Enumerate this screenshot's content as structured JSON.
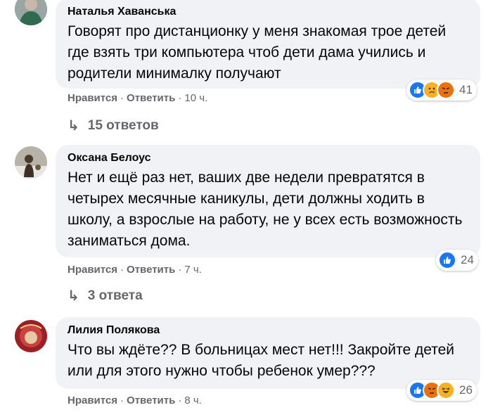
{
  "comments": [
    {
      "author": "Наталья Хаванська",
      "text": "Говорят про дистанционку у меня знакомая трое детей где взять три компьютера чтоб дети дама учились и родители минималку получают",
      "like_label": "Нравится",
      "reply_label": "Ответить",
      "time": "10 ч.",
      "reactions": [
        "like-icon",
        "sad-icon",
        "angry-icon"
      ],
      "reaction_count": "41",
      "replies_label": "15 ответов"
    },
    {
      "author": "Оксана Белоус",
      "text": "Нет и ещё раз нет, ваших две недели превратятся в четырех месячные каникулы, дети должны ходить в школу, а взрослые на работу, не у всех есть возможность заниматься дома.",
      "like_label": "Нравится",
      "reply_label": "Ответить",
      "time": "7 ч.",
      "reactions": [
        "like-icon"
      ],
      "reaction_count": "24",
      "replies_label": "3 ответа"
    },
    {
      "author": "Лилия Полякова",
      "text": "Что вы ждёте?? В больницах мест нет!!! Закройте детей или для этого нужно чтобы ребенок умер???",
      "like_label": "Нравится",
      "reply_label": "Ответить",
      "time": "8 ч.",
      "reactions": [
        "like-icon",
        "angry-icon",
        "haha-icon"
      ],
      "reaction_count": "26"
    }
  ],
  "separator": "·",
  "reply_arrow": "↳",
  "colors": {
    "like": "#1877f2",
    "sad": "#f7b125",
    "angry": "#e9710f",
    "bubble": "#f0f2f5",
    "meta": "#65676b"
  }
}
